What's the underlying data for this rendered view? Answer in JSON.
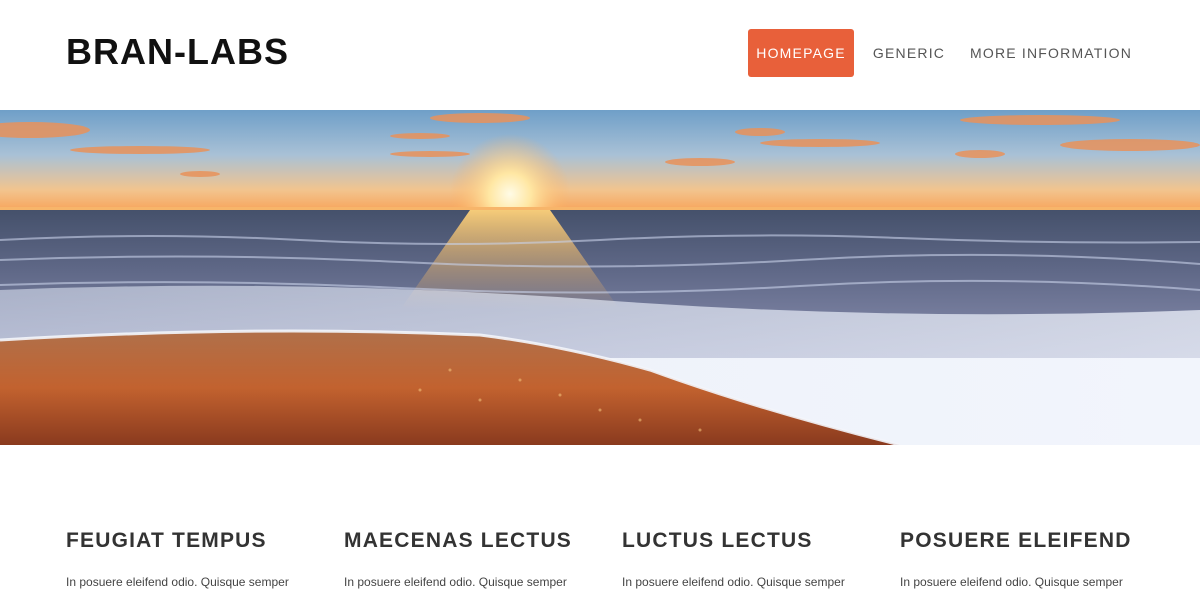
{
  "header": {
    "logo": "BRAN-LABS",
    "nav": [
      {
        "label": "HOMEPAGE",
        "active": true
      },
      {
        "label": "GENERIC",
        "active": false
      },
      {
        "label": "MORE INFORMATION",
        "active": false
      }
    ]
  },
  "hero": {
    "image": "sunset-beach-photo"
  },
  "features": [
    {
      "title": "FEUGIAT TEMPUS",
      "text": "In posuere eleifend odio. Quisque semper"
    },
    {
      "title": "MAECENAS LECTUS",
      "text": "In posuere eleifend odio. Quisque semper"
    },
    {
      "title": "LUCTUS LECTUS",
      "text": "In posuere eleifend odio. Quisque semper"
    },
    {
      "title": "POSUERE ELEIFEND",
      "text": "In posuere eleifend odio. Quisque semper"
    }
  ],
  "colors": {
    "accent": "#e8603a",
    "text": "#333333",
    "background": "#ffffff"
  }
}
